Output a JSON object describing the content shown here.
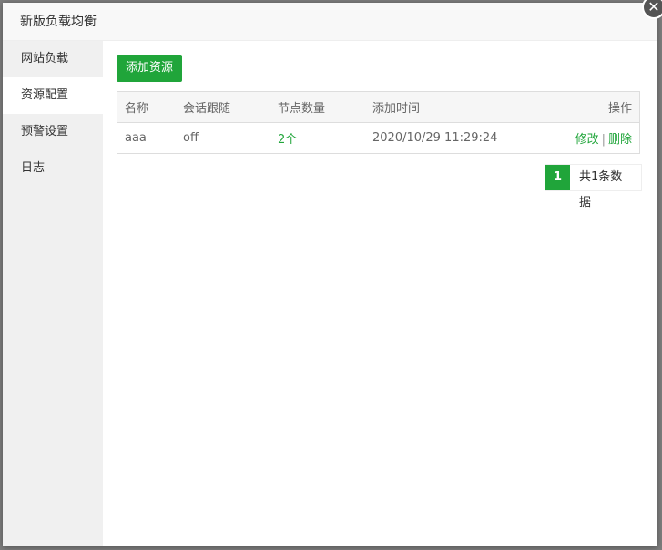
{
  "dialog": {
    "title": "新版负载均衡",
    "close_icon": "close-icon"
  },
  "sidebar": {
    "items": [
      {
        "label": "网站负载",
        "active": false
      },
      {
        "label": "资源配置",
        "active": true
      },
      {
        "label": "预警设置",
        "active": false
      },
      {
        "label": "日志",
        "active": false
      }
    ]
  },
  "toolbar": {
    "add_label": "添加资源"
  },
  "table": {
    "headers": [
      "名称",
      "会话跟随",
      "节点数量",
      "添加时间",
      "操作"
    ],
    "rows": [
      {
        "name": "aaa",
        "session": "off",
        "nodes": "2个",
        "time": "2020/10/29 11:29:24",
        "edit": "修改",
        "sep": "|",
        "delete": "删除"
      }
    ]
  },
  "pager": {
    "current": "1",
    "total": "共1条数据"
  },
  "colors": {
    "accent": "#20a53a"
  }
}
